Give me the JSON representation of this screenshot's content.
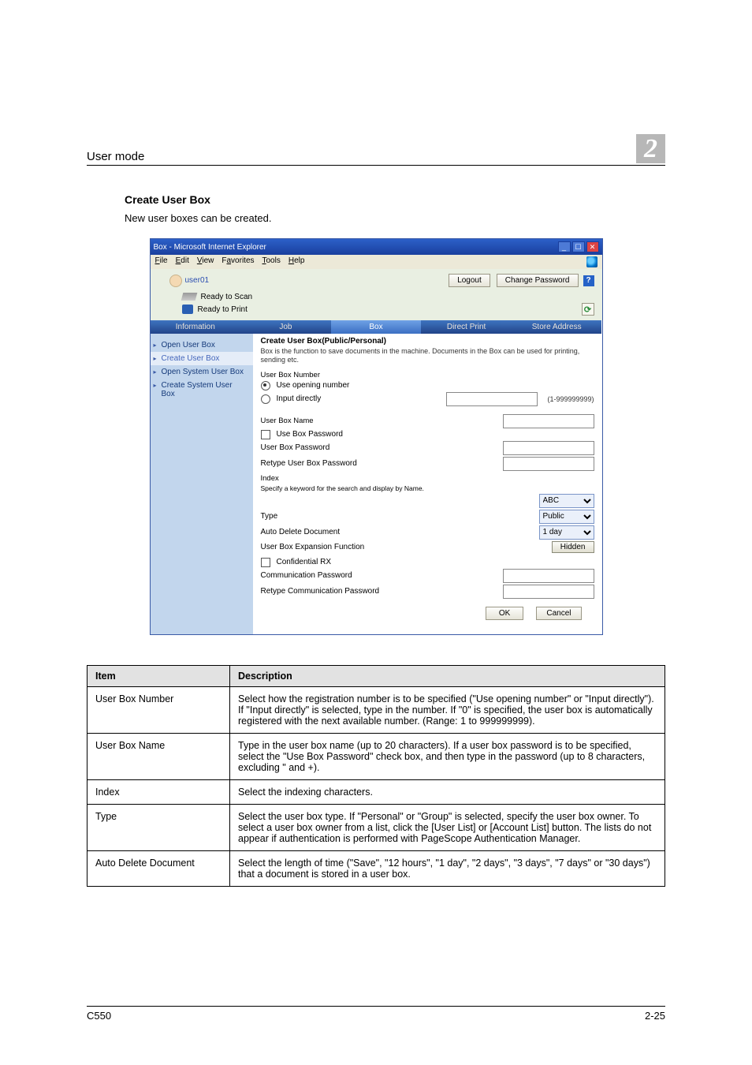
{
  "header": {
    "title": "User mode",
    "chapter": "2"
  },
  "section": {
    "title": "Create User Box",
    "intro": "New user boxes can be created."
  },
  "browser": {
    "window_title": "Box - Microsoft Internet Explorer",
    "menu": {
      "file": "File",
      "edit": "Edit",
      "view": "View",
      "favorites": "Favorites",
      "tools": "Tools",
      "help": "Help"
    },
    "user": "user01",
    "logout": "Logout",
    "change_pw": "Change Password",
    "status1": "Ready to Scan",
    "status2": "Ready to Print",
    "tabs": {
      "info": "Information",
      "job": "Job",
      "box": "Box",
      "direct": "Direct Print",
      "store": "Store Address"
    },
    "sidebar": {
      "open_user": "Open User Box",
      "create_user": "Create User Box",
      "open_system": "Open System User Box",
      "create_system": "Create System User Box"
    },
    "form": {
      "title": "Create User Box(Public/Personal)",
      "desc": "Box is the function to save documents in the machine.\nDocuments in the Box can be used for printing, sending etc.",
      "user_box_number": "User Box Number",
      "use_opening": "Use opening number",
      "input_directly": "Input directly",
      "range_hint": "(1-999999999)",
      "user_box_name": "User Box Name",
      "use_box_password": "Use Box Password",
      "user_box_password": "User Box Password",
      "retype_user_box_password": "Retype User Box Password",
      "index": "Index",
      "index_desc": "Specify a keyword for the search and display by Name.",
      "index_value": "ABC",
      "type": "Type",
      "type_value": "Public",
      "auto_delete": "Auto Delete Document",
      "auto_delete_value": "1 day",
      "expansion": "User Box Expansion Function",
      "hidden": "Hidden",
      "confidential_rx": "Confidential RX",
      "comm_password": "Communication Password",
      "retype_comm_password": "Retype Communication Password",
      "ok": "OK",
      "cancel": "Cancel"
    }
  },
  "table": {
    "head_item": "Item",
    "head_desc": "Description",
    "rows": [
      {
        "item": "User Box Number",
        "desc": "Select how the registration number is to be specified (\"Use opening number\" or \"Input directly\"). If \"Input directly\" is selected, type in the number. If \"0\" is specified, the user box is automatically registered with the next available number. (Range: 1 to 999999999)."
      },
      {
        "item": "User Box Name",
        "desc": "Type in the user box name (up to 20 characters). If a user box password is to be specified, select the \"Use Box Password\" check box, and then type in the password (up to 8 characters, excluding \" and +)."
      },
      {
        "item": "Index",
        "desc": "Select the indexing characters."
      },
      {
        "item": "Type",
        "desc": "Select the user box type. If \"Personal\" or \"Group\" is selected, specify the user box owner. To select a user box owner from a list, click the [User List] or [Account List] button.\nThe lists do not appear if authentication is performed with PageScope Authentication Manager."
      },
      {
        "item": "Auto Delete Document",
        "desc": "Select the length of time (\"Save\", \"12 hours\", \"1 day\", \"2 days\", \"3 days\", \"7 days\" or \"30 days\") that a document is stored in a user box."
      }
    ]
  },
  "footer": {
    "model": "C550",
    "page": "2-25"
  }
}
